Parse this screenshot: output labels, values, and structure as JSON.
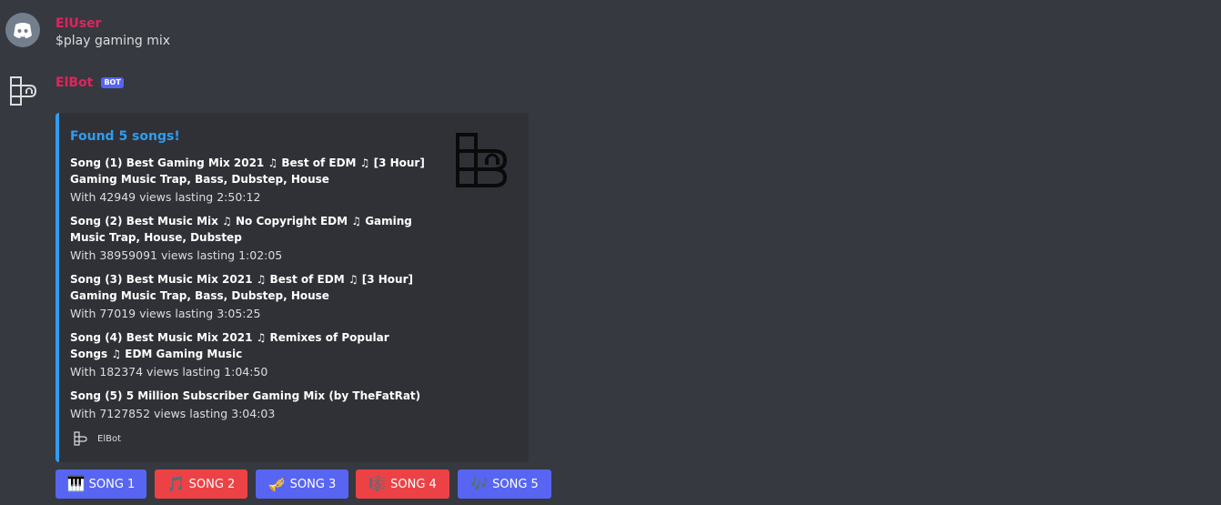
{
  "messages": {
    "user": {
      "author": "ElUser",
      "text": "$play gaming mix"
    },
    "bot": {
      "author": "ElBot",
      "badge": "BOT"
    }
  },
  "embed": {
    "accent_color": "#2f9df0",
    "title": "Found 5 songs!",
    "songs": [
      {
        "title": "Song (1) Best Gaming Mix 2021 ♫ Best of EDM ♫ [3 Hour] Gaming Music Trap, Bass, Dubstep, House",
        "meta": "With 42949 views lasting 2:50:12"
      },
      {
        "title": "Song (2) Best Music Mix ♫ No Copyright EDM ♫ Gaming Music Trap, House, Dubstep",
        "meta": "With 38959091 views lasting 1:02:05"
      },
      {
        "title": "Song (3) Best Music Mix 2021 ♫ Best of EDM ♫ [3 Hour] Gaming Music  Trap, Bass, Dubstep, House",
        "meta": "With 77019 views lasting 3:05:25"
      },
      {
        "title": "Song (4) Best Music Mix 2021 ♫ Remixes of Popular Songs ♫ EDM Gaming Music",
        "meta": "With 182374 views lasting 1:04:50"
      },
      {
        "title": "Song (5) 5 Million Subscriber Gaming Mix (by TheFatRat)",
        "meta": "With 7127852 views lasting 3:04:03"
      }
    ],
    "footer": "ElBot"
  },
  "buttons": [
    {
      "label": "SONG 1",
      "emoji": "🎹",
      "icon": "piano-icon",
      "color": "#5865f2"
    },
    {
      "label": "SONG 2",
      "emoji": "🎵",
      "icon": "music-note-icon",
      "color": "#ed4245"
    },
    {
      "label": "SONG 3",
      "emoji": "🎺",
      "icon": "trumpet-icon",
      "color": "#5865f2"
    },
    {
      "label": "SONG 4",
      "emoji": "🎼",
      "icon": "musical-score-icon",
      "color": "#ed4245"
    },
    {
      "label": "SONG 5",
      "emoji": "🎶",
      "icon": "music-notes-icon",
      "color": "#5865f2"
    }
  ]
}
